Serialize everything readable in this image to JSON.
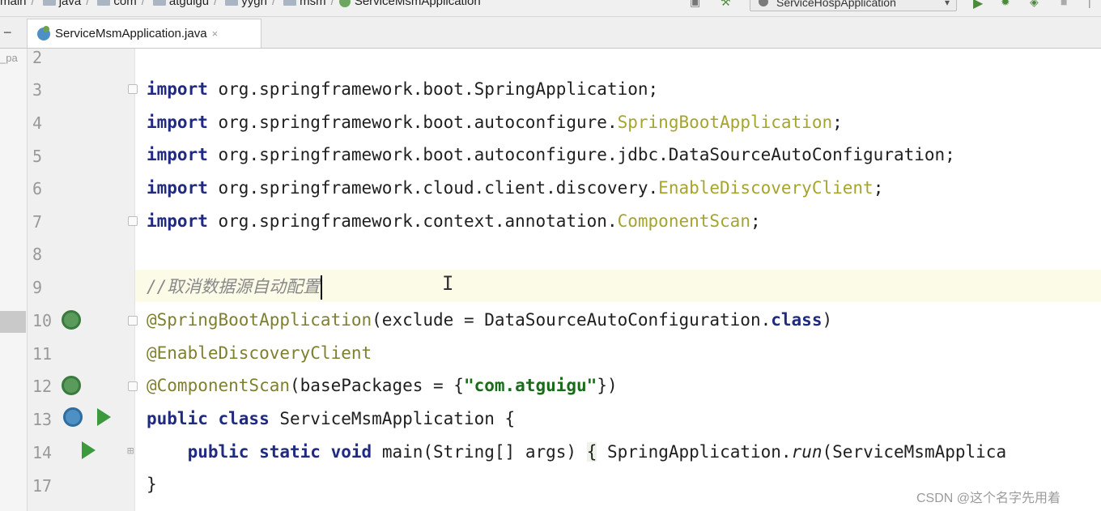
{
  "breadcrumbs": [
    "main",
    "java",
    "com",
    "atguigu",
    "yygh",
    "msm",
    "ServiceMsmApplication"
  ],
  "run_config": "ServiceHospApplication",
  "tab": {
    "label": "ServiceMsmApplication.java"
  },
  "project_label": "_pa",
  "line_numbers": [
    "2",
    "3",
    "4",
    "5",
    "6",
    "7",
    "8",
    "9",
    "10",
    "11",
    "12",
    "13",
    "14",
    "17"
  ],
  "code": {
    "l3": {
      "kw": "import",
      "pkg": "org.springframework.boot.SpringApplication;"
    },
    "l4": {
      "kw": "import",
      "pkg": "org.springframework.boot.autoconfigure.",
      "cls": "SpringBootApplication",
      "end": ";"
    },
    "l5": {
      "kw": "import",
      "pkg": "org.springframework.boot.autoconfigure.jdbc.DataSourceAutoConfiguration;"
    },
    "l6": {
      "kw": "import",
      "pkg": "org.springframework.cloud.client.discovery.",
      "cls": "EnableDiscoveryClient",
      "end": ";"
    },
    "l7": {
      "kw": "import",
      "pkg": "org.springframework.context.annotation.",
      "cls": "ComponentScan",
      "end": ";"
    },
    "l9": {
      "comment": "//取消数据源自动配置"
    },
    "l10": {
      "ann": "@SpringBootApplication",
      "args": "(exclude = DataSourceAutoConfiguration.",
      "kw": "class",
      "end": ")"
    },
    "l11": {
      "ann": "@EnableDiscoveryClient"
    },
    "l12": {
      "ann": "@ComponentScan",
      "args": "(basePackages = {",
      "str": "\"com.atguigu\"",
      "end": "})"
    },
    "l13": {
      "kw": "public class",
      "rest": "ServiceMsmApplication {"
    },
    "l14": {
      "kw": "public static void",
      "rest": "main(String[] args) ",
      "brace": "{",
      "call": "SpringApplication.",
      "run": "run",
      "tail": "(ServiceMsmApplica"
    },
    "l17": {
      "text": "}"
    }
  },
  "watermark": "CSDN @这个名字先用着",
  "colors": {
    "keyword": "#1f2a80",
    "annotation": "#7f7f30",
    "class_ref": "#a5a52d",
    "string": "#1a6b1a",
    "comment": "#888888",
    "line_number": "#999999"
  },
  "icons": [
    "folder-icon",
    "spring-icon",
    "bean-icon",
    "run-icon",
    "close-icon",
    "fold-icon"
  ]
}
